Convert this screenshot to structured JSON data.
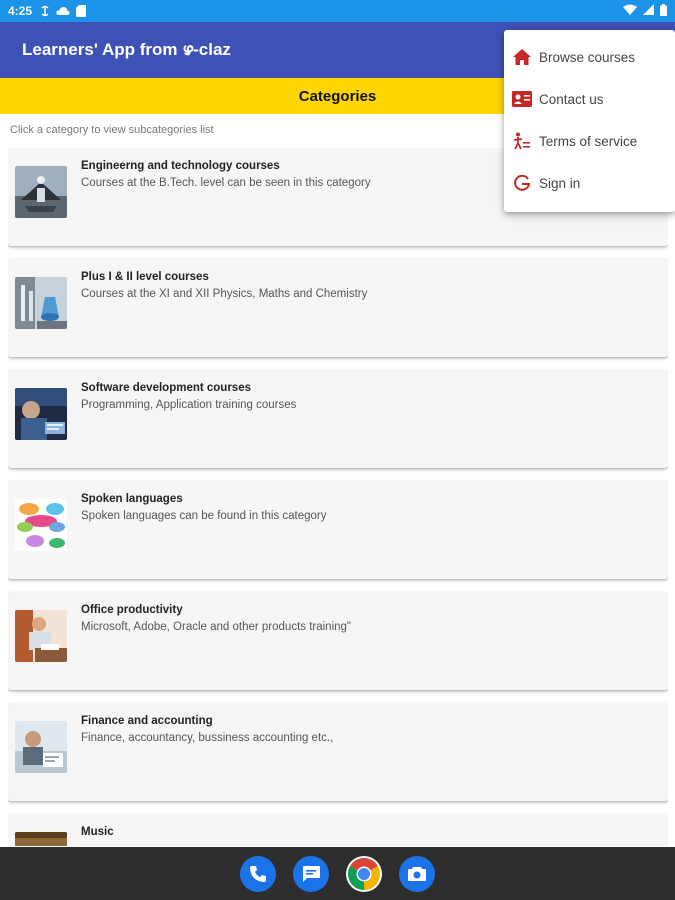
{
  "status_bar": {
    "time": "4:25"
  },
  "app_bar": {
    "title": "Learners' App from ഴ-claz"
  },
  "category_bar": {
    "title": "Categories"
  },
  "hint": "Click a category to view subcategories list",
  "categories": [
    {
      "title": "Engineerng and technology courses",
      "description": "Courses at the B.Tech. level can be seen in this category",
      "thumb_icon": "engineering-thumbnail"
    },
    {
      "title": "Plus I & II level courses",
      "description": "Courses at the XI and XII Physics, Maths and Chemistry",
      "thumb_icon": "lab-thumbnail"
    },
    {
      "title": "Software development courses",
      "description": "Programming, Application training courses",
      "thumb_icon": "software-thumbnail"
    },
    {
      "title": "Spoken languages",
      "description": "Spoken languages can be found in this category",
      "thumb_icon": "speech-bubbles-thumbnail"
    },
    {
      "title": "Office productivity",
      "description": "Microsoft,  Adobe, Oracle and other products training\"",
      "thumb_icon": "office-thumbnail"
    },
    {
      "title": "Finance and accounting",
      "description": "Finance, accountancy, bussiness accounting etc.,",
      "thumb_icon": "finance-thumbnail"
    },
    {
      "title": "Music",
      "description": "",
      "thumb_icon": "music-thumbnail"
    }
  ],
  "menu": {
    "items": [
      {
        "label": "Browse courses",
        "icon": "home-icon"
      },
      {
        "label": "Contact us",
        "icon": "contact-card-icon"
      },
      {
        "label": "Terms of service",
        "icon": "terms-icon"
      },
      {
        "label": "Sign in",
        "icon": "google-icon"
      }
    ]
  },
  "dock": [
    "phone-icon",
    "messages-icon",
    "chrome-icon",
    "camera-icon"
  ],
  "colors": {
    "status_bar": "#1a93e8",
    "app_bar": "#3f51b5",
    "category_bar": "#ffd600",
    "menu_icon": "#c62828",
    "nav_bar": "#2d2d2d"
  }
}
